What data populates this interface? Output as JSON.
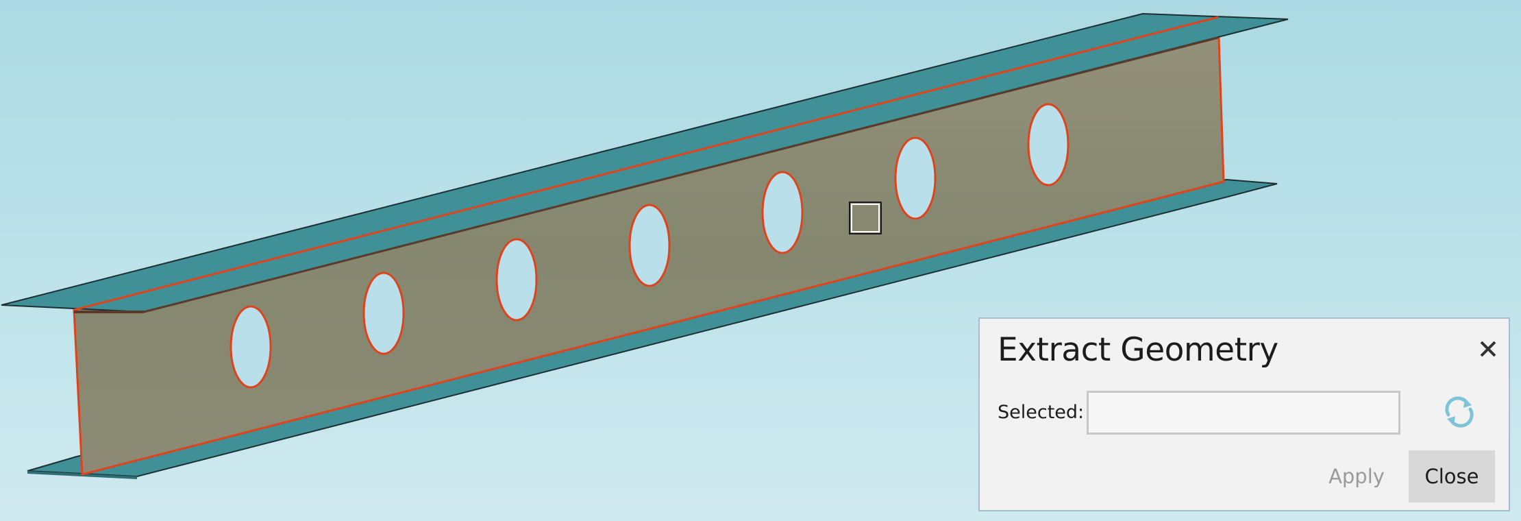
{
  "viewport": {
    "background_top": "#acd9e3",
    "background_bottom": "#cfe9ef",
    "flange_color": "#3f9197",
    "web_color": "#8a8a73",
    "highlight_edge_color": "#e0421a",
    "model_icon": "i-beam-model-icon"
  },
  "dialog": {
    "title": "Extract Geometry",
    "close_icon": "close-icon",
    "selected_label": "Selected:",
    "selected_value": "",
    "selected_placeholder": "",
    "refresh_icon": "refresh-icon",
    "refresh_color": "#7fc4d6",
    "apply_label": "Apply",
    "close_label": "Close"
  }
}
